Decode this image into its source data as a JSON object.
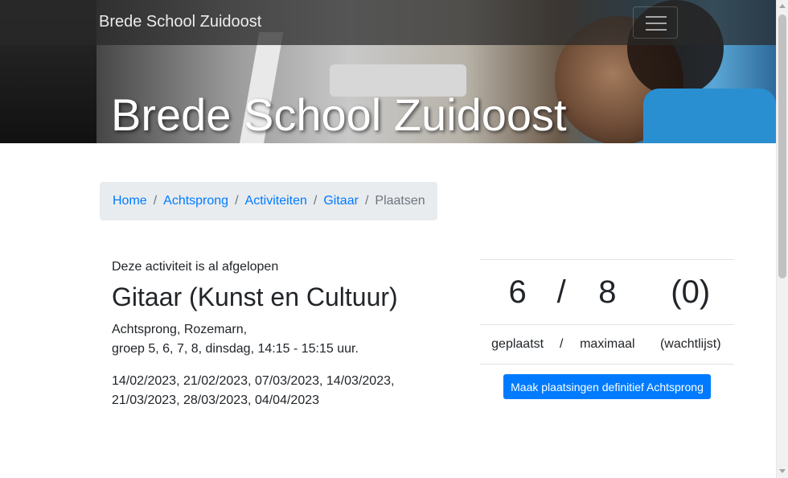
{
  "navbar": {
    "brand": "Brede School Zuidoost",
    "toggler_icon": "hamburger-menu-icon"
  },
  "hero": {
    "title": "Brede School Zuidoost"
  },
  "breadcrumb": {
    "items": [
      "Home",
      "Achtsprong",
      "Activiteiten",
      "Gitaar"
    ],
    "active": "Plaatsen",
    "separator": "/"
  },
  "activity": {
    "status": "Deze activiteit is al afgelopen",
    "title": "Gitaar (Kunst en Cultuur)",
    "location_line": "Achtsprong, Rozemarn,",
    "schedule_line": "groep 5, 6, 7, 8, dinsdag, 14:15 - 15:15 uur.",
    "dates_line1": "14/02/2023, 21/02/2023, 07/03/2023, 14/03/2023,",
    "dates_line2": "21/03/2023, 28/03/2023, 04/04/2023"
  },
  "counts": {
    "placed": "6",
    "separator": "/",
    "maximum": "8",
    "waitlist": "(0)",
    "placed_label": "geplaatst",
    "separator_label": "/",
    "maximum_label": "maximaal",
    "waitlist_label": "(wachtlijst)"
  },
  "actions": {
    "finalize_label": "Maak plaatsingen definitief Achtsprong"
  },
  "colors": {
    "primary": "#007bff",
    "breadcrumb_bg": "#e9ecef",
    "muted": "#6c757d"
  }
}
